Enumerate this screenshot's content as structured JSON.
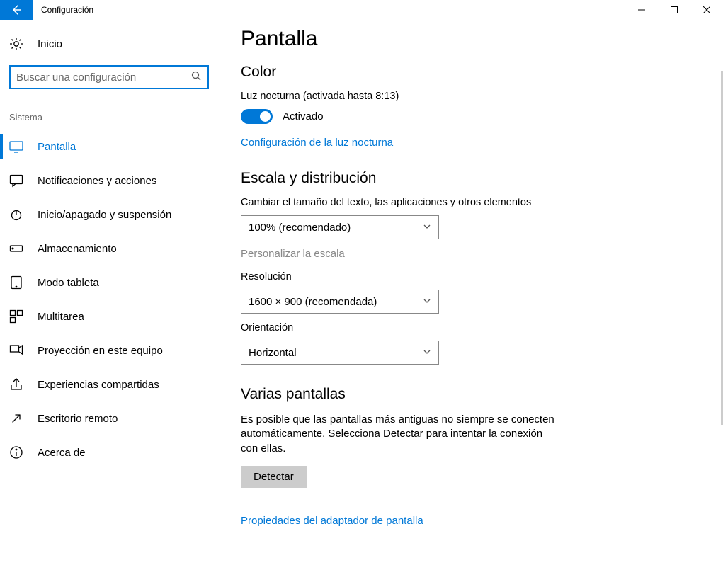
{
  "window": {
    "title": "Configuración"
  },
  "sidebar": {
    "home_label": "Inicio",
    "search_placeholder": "Buscar una configuración",
    "section_label": "Sistema",
    "items": [
      {
        "label": "Pantalla",
        "icon": "display"
      },
      {
        "label": "Notificaciones y acciones",
        "icon": "message"
      },
      {
        "label": "Inicio/apagado y suspensión",
        "icon": "power"
      },
      {
        "label": "Almacenamiento",
        "icon": "storage"
      },
      {
        "label": "Modo tableta",
        "icon": "tablet"
      },
      {
        "label": "Multitarea",
        "icon": "multitask"
      },
      {
        "label": "Proyección en este equipo",
        "icon": "project"
      },
      {
        "label": "Experiencias compartidas",
        "icon": "share"
      },
      {
        "label": "Escritorio remoto",
        "icon": "remote"
      },
      {
        "label": "Acerca de",
        "icon": "info"
      }
    ]
  },
  "page": {
    "title": "Pantalla",
    "color": {
      "header": "Color",
      "night_light_label": "Luz nocturna (activada hasta 8:13)",
      "toggle_state": "Activado",
      "night_light_link": "Configuración de la luz nocturna"
    },
    "scale": {
      "header": "Escala y distribución",
      "resize_label": "Cambiar el tamaño del texto, las aplicaciones y otros elementos",
      "scale_value": "100% (recomendado)",
      "custom_link": "Personalizar la escala",
      "resolution_label": "Resolución",
      "resolution_value": "1600 × 900 (recomendada)",
      "orientation_label": "Orientación",
      "orientation_value": "Horizontal"
    },
    "multi": {
      "header": "Varias pantallas",
      "desc": "Es posible que las pantallas más antiguas no siempre se conecten automáticamente. Selecciona Detectar para intentar la conexión con ellas.",
      "detect_btn": "Detectar",
      "adapter_link": "Propiedades del adaptador de pantalla"
    }
  }
}
